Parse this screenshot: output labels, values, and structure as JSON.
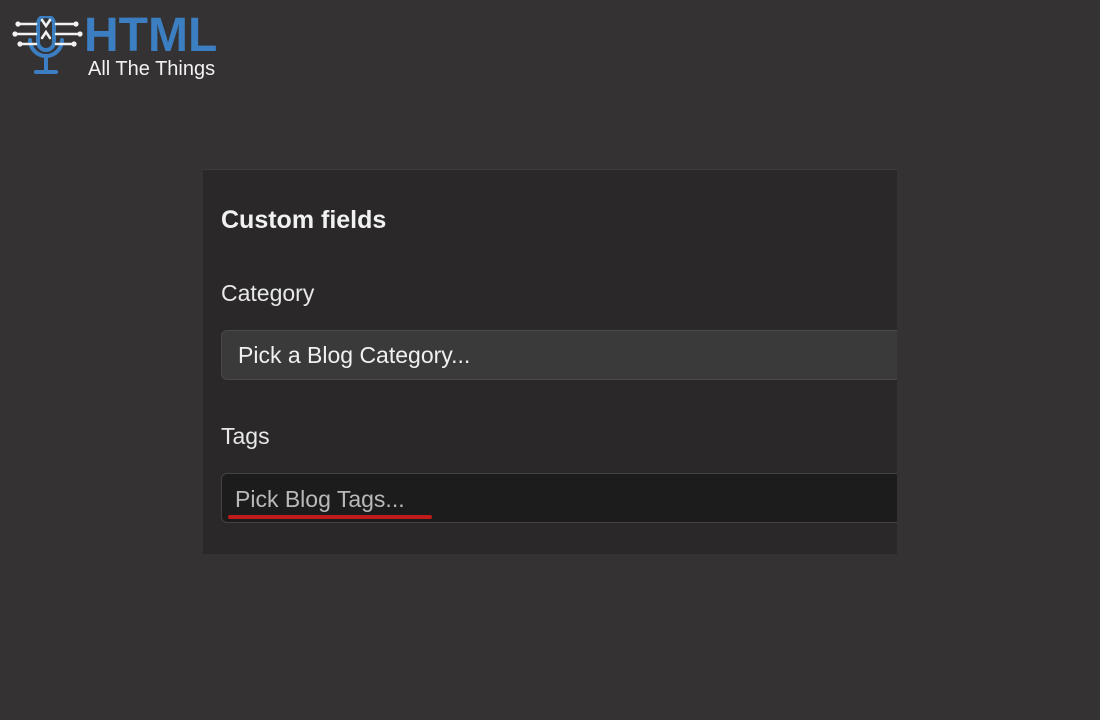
{
  "logo": {
    "title": "HTML",
    "subtitle": "All The Things",
    "icon": "microphone-circuit-icon",
    "brand_color": "#3b7fc2"
  },
  "panel": {
    "title": "Custom fields",
    "category": {
      "label": "Category",
      "placeholder": "Pick a Blog Category..."
    },
    "tags": {
      "label": "Tags",
      "placeholder": "Pick Blog Tags...",
      "spellcheck_underline_color": "#c01b1b"
    }
  }
}
